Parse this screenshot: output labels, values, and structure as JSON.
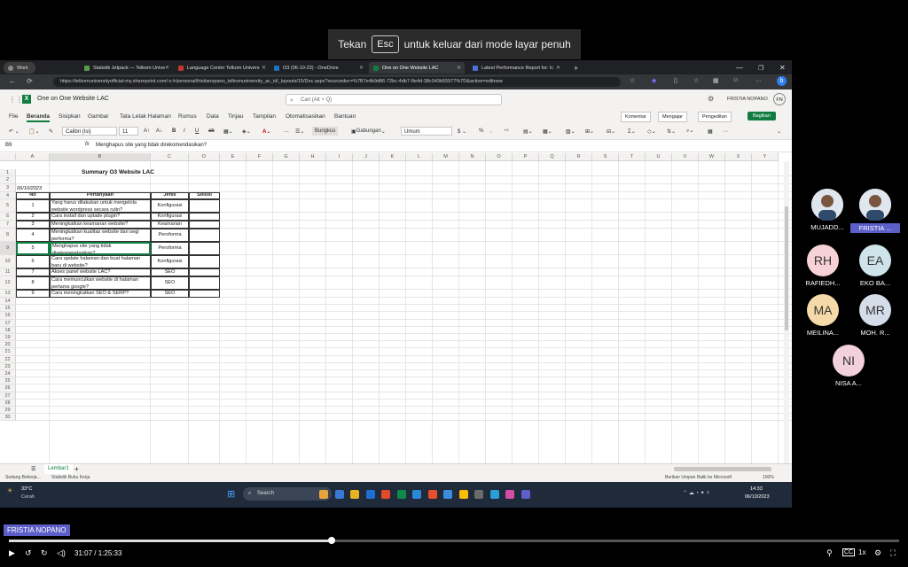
{
  "esc_hint": {
    "prefix": "Tekan",
    "key": "Esc",
    "suffix": "untuk keluar dari mode layar penuh"
  },
  "browser": {
    "profile": "Work",
    "tabs": [
      {
        "label": "Statistik Jetpack — Telkom Unive",
        "color": "#5a9b50"
      },
      {
        "label": "Language Center Telkom Univers",
        "color": "#c0392b"
      },
      {
        "label": "O3 (06-10-23) - OneDrive",
        "color": "#1e73be"
      },
      {
        "label": "One on One Website LAC",
        "color": "#107c41"
      },
      {
        "label": "Latest Performance Report for: lc",
        "color": "#4a6fd6"
      }
    ],
    "url": "https://telkomuniversityofficial-my.sharepoint.com/:x:/r/personal/fristianopano_telkomuniversity_ac_id/_layouts/15/Doc.aspx?sourcedoc=%7B7e4b9d86-72bc-4db7-8e4d-38c043b55977%7D&action=editnew",
    "zoom_badge": "A"
  },
  "excel": {
    "doc_title": "One on One Website LAC",
    "search_placeholder": "Cari (Alt + Q)",
    "user_name": "FRISTIA NOPANO",
    "user_initials": "FN",
    "menu": [
      "File",
      "Beranda",
      "Sisipkan",
      "Gambar",
      "Tata Letak Halaman",
      "Rumus",
      "Data",
      "Tinjau",
      "Tampilan",
      "Otomatisasikan",
      "Bantuan"
    ],
    "active_menu": "Beranda",
    "menu_right": {
      "comment": "Komentar",
      "present": "Mengajar",
      "editing": "Pengeditan",
      "share": "Bagikan"
    },
    "toolbar": {
      "font": "Calibri (Isi)",
      "size": "11",
      "wrap": "Bungkus",
      "merge": "Gabungan",
      "number_format": "Umum"
    },
    "cell_ref": "B9",
    "formula": "Menghapus site yang tidak direkomendasikan?",
    "columns": [
      "A",
      "B",
      "C",
      "D",
      "E",
      "F",
      "G",
      "H",
      "I",
      "J",
      "K",
      "L",
      "M",
      "N",
      "O",
      "P",
      "Q",
      "R",
      "S",
      "T",
      "U",
      "V",
      "W",
      "X",
      "Y"
    ],
    "rows": [
      "1",
      "2",
      "3",
      "4",
      "5",
      "6",
      "7",
      "8",
      "9",
      "10",
      "11",
      "12",
      "13",
      "14",
      "15",
      "16",
      "17",
      "18",
      "19",
      "20",
      "21",
      "22",
      "23",
      "24",
      "25",
      "26",
      "27",
      "28",
      "29",
      "30"
    ],
    "sheet_title": "Summary O3 Website LAC",
    "date": "06/10/2023",
    "table_headers": [
      "No",
      "Pertanyaan",
      "Jenis",
      "Solusi"
    ],
    "table_rows": [
      {
        "no": "1",
        "q": "Yang harus dilakukan untuk mengelola website wordpress secara rutin?",
        "jenis": "Konfigurasi",
        "solusi": ""
      },
      {
        "no": "2",
        "q": "Cara install dan uptade plugin?",
        "jenis": "Konfigurasi",
        "solusi": ""
      },
      {
        "no": "3",
        "q": "Meningkatkan keamanan website?",
        "jenis": "Keamanan",
        "solusi": ""
      },
      {
        "no": "4",
        "q": "Meningkatkan kualitas website dari segi performa?",
        "jenis": "Peroforma",
        "solusi": ""
      },
      {
        "no": "5",
        "q": "Menghapus site yang tidak direkomendasikan?",
        "jenis": "Peroforma",
        "solusi": ""
      },
      {
        "no": "6",
        "q": "Cara update halaman dan buat halaman baru di website?",
        "jenis": "Konfigurasi",
        "solusi": ""
      },
      {
        "no": "7",
        "q": "Akses panel website LAC?",
        "jenis": "SEO",
        "solusi": ""
      },
      {
        "no": "8",
        "q": "Cara memunculkan website di halaman pertama google?",
        "jenis": "SEO",
        "solusi": ""
      },
      {
        "no": "9",
        "q": "Cara meningkatkan SEO & SERP?",
        "jenis": "SEO",
        "solusi": ""
      }
    ],
    "sheet_tab": "Lembar1",
    "status_left": [
      "Sedang Bekerja...",
      "Statistik Buku Kerja"
    ],
    "status_right": [
      "Berikan Umpan Balik ke Microsoft",
      "100%"
    ]
  },
  "taskbar": {
    "weather_temp": "33°C",
    "weather_desc": "Cerah",
    "search_label": "Search",
    "time": "14:33",
    "date": "06/10/2023"
  },
  "participants": [
    {
      "initials": "",
      "name": "MUJADD...",
      "color": "#ffffff",
      "photo": true
    },
    {
      "initials": "",
      "name": "FRISTIA ...",
      "color": "#ffffff",
      "photo": true,
      "highlight": true
    },
    {
      "initials": "RH",
      "name": "RAFIEDH...",
      "color": "#f6d1d6"
    },
    {
      "initials": "EA",
      "name": "EKO BA...",
      "color": "#cfe3ea"
    },
    {
      "initials": "MA",
      "name": "MEILINA...",
      "color": "#f5d9a8"
    },
    {
      "initials": "MR",
      "name": "MOH. R...",
      "color": "#d4dde8"
    },
    {
      "initials": "NI",
      "name": "NISA A...",
      "color": "#f2d0dc"
    }
  ],
  "speaker_label": "FRISTIA NOPANO",
  "player": {
    "current_time": "31:07",
    "total_time": "1:25:33",
    "progress_fraction": 0.363,
    "speed": "1x"
  }
}
